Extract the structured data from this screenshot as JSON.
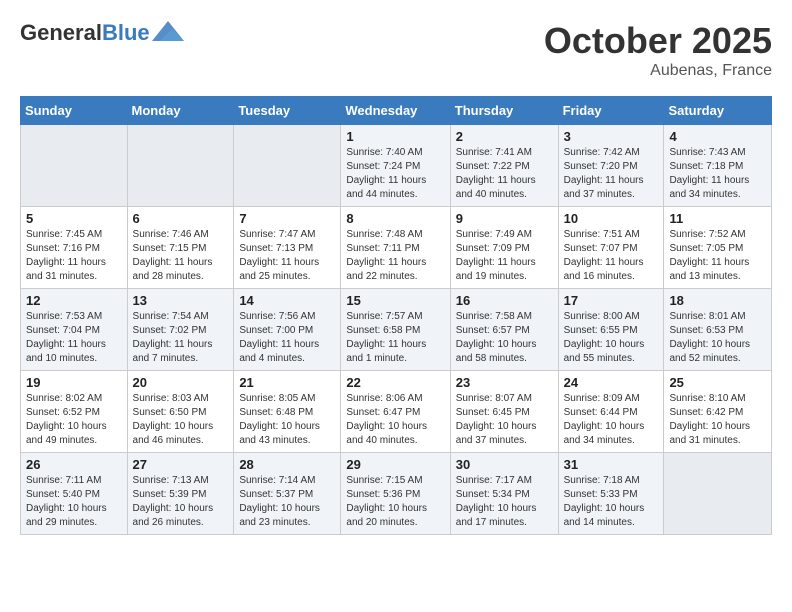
{
  "header": {
    "logo_general": "General",
    "logo_blue": "Blue",
    "month": "October 2025",
    "location": "Aubenas, France"
  },
  "weekdays": [
    "Sunday",
    "Monday",
    "Tuesday",
    "Wednesday",
    "Thursday",
    "Friday",
    "Saturday"
  ],
  "weeks": [
    [
      {
        "day": "",
        "text": ""
      },
      {
        "day": "",
        "text": ""
      },
      {
        "day": "",
        "text": ""
      },
      {
        "day": "1",
        "text": "Sunrise: 7:40 AM\nSunset: 7:24 PM\nDaylight: 11 hours and 44 minutes."
      },
      {
        "day": "2",
        "text": "Sunrise: 7:41 AM\nSunset: 7:22 PM\nDaylight: 11 hours and 40 minutes."
      },
      {
        "day": "3",
        "text": "Sunrise: 7:42 AM\nSunset: 7:20 PM\nDaylight: 11 hours and 37 minutes."
      },
      {
        "day": "4",
        "text": "Sunrise: 7:43 AM\nSunset: 7:18 PM\nDaylight: 11 hours and 34 minutes."
      }
    ],
    [
      {
        "day": "5",
        "text": "Sunrise: 7:45 AM\nSunset: 7:16 PM\nDaylight: 11 hours and 31 minutes."
      },
      {
        "day": "6",
        "text": "Sunrise: 7:46 AM\nSunset: 7:15 PM\nDaylight: 11 hours and 28 minutes."
      },
      {
        "day": "7",
        "text": "Sunrise: 7:47 AM\nSunset: 7:13 PM\nDaylight: 11 hours and 25 minutes."
      },
      {
        "day": "8",
        "text": "Sunrise: 7:48 AM\nSunset: 7:11 PM\nDaylight: 11 hours and 22 minutes."
      },
      {
        "day": "9",
        "text": "Sunrise: 7:49 AM\nSunset: 7:09 PM\nDaylight: 11 hours and 19 minutes."
      },
      {
        "day": "10",
        "text": "Sunrise: 7:51 AM\nSunset: 7:07 PM\nDaylight: 11 hours and 16 minutes."
      },
      {
        "day": "11",
        "text": "Sunrise: 7:52 AM\nSunset: 7:05 PM\nDaylight: 11 hours and 13 minutes."
      }
    ],
    [
      {
        "day": "12",
        "text": "Sunrise: 7:53 AM\nSunset: 7:04 PM\nDaylight: 11 hours and 10 minutes."
      },
      {
        "day": "13",
        "text": "Sunrise: 7:54 AM\nSunset: 7:02 PM\nDaylight: 11 hours and 7 minutes."
      },
      {
        "day": "14",
        "text": "Sunrise: 7:56 AM\nSunset: 7:00 PM\nDaylight: 11 hours and 4 minutes."
      },
      {
        "day": "15",
        "text": "Sunrise: 7:57 AM\nSunset: 6:58 PM\nDaylight: 11 hours and 1 minute."
      },
      {
        "day": "16",
        "text": "Sunrise: 7:58 AM\nSunset: 6:57 PM\nDaylight: 10 hours and 58 minutes."
      },
      {
        "day": "17",
        "text": "Sunrise: 8:00 AM\nSunset: 6:55 PM\nDaylight: 10 hours and 55 minutes."
      },
      {
        "day": "18",
        "text": "Sunrise: 8:01 AM\nSunset: 6:53 PM\nDaylight: 10 hours and 52 minutes."
      }
    ],
    [
      {
        "day": "19",
        "text": "Sunrise: 8:02 AM\nSunset: 6:52 PM\nDaylight: 10 hours and 49 minutes."
      },
      {
        "day": "20",
        "text": "Sunrise: 8:03 AM\nSunset: 6:50 PM\nDaylight: 10 hours and 46 minutes."
      },
      {
        "day": "21",
        "text": "Sunrise: 8:05 AM\nSunset: 6:48 PM\nDaylight: 10 hours and 43 minutes."
      },
      {
        "day": "22",
        "text": "Sunrise: 8:06 AM\nSunset: 6:47 PM\nDaylight: 10 hours and 40 minutes."
      },
      {
        "day": "23",
        "text": "Sunrise: 8:07 AM\nSunset: 6:45 PM\nDaylight: 10 hours and 37 minutes."
      },
      {
        "day": "24",
        "text": "Sunrise: 8:09 AM\nSunset: 6:44 PM\nDaylight: 10 hours and 34 minutes."
      },
      {
        "day": "25",
        "text": "Sunrise: 8:10 AM\nSunset: 6:42 PM\nDaylight: 10 hours and 31 minutes."
      }
    ],
    [
      {
        "day": "26",
        "text": "Sunrise: 7:11 AM\nSunset: 5:40 PM\nDaylight: 10 hours and 29 minutes."
      },
      {
        "day": "27",
        "text": "Sunrise: 7:13 AM\nSunset: 5:39 PM\nDaylight: 10 hours and 26 minutes."
      },
      {
        "day": "28",
        "text": "Sunrise: 7:14 AM\nSunset: 5:37 PM\nDaylight: 10 hours and 23 minutes."
      },
      {
        "day": "29",
        "text": "Sunrise: 7:15 AM\nSunset: 5:36 PM\nDaylight: 10 hours and 20 minutes."
      },
      {
        "day": "30",
        "text": "Sunrise: 7:17 AM\nSunset: 5:34 PM\nDaylight: 10 hours and 17 minutes."
      },
      {
        "day": "31",
        "text": "Sunrise: 7:18 AM\nSunset: 5:33 PM\nDaylight: 10 hours and 14 minutes."
      },
      {
        "day": "",
        "text": ""
      }
    ]
  ]
}
